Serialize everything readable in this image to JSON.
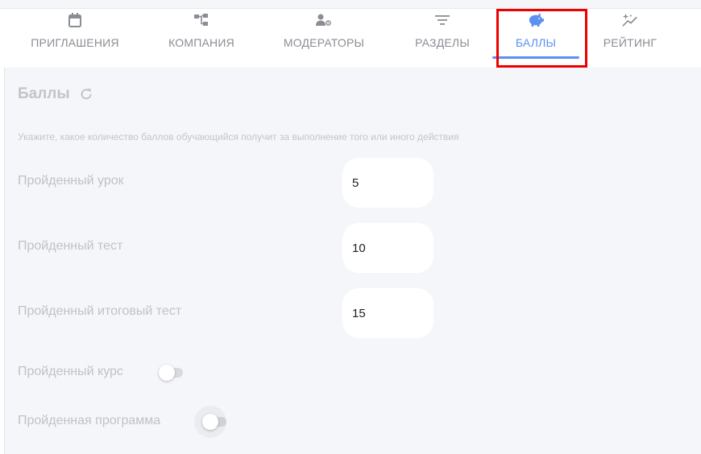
{
  "tabs": [
    {
      "label": "ПРИГЛАШЕНИЯ",
      "icon": "calendar-icon"
    },
    {
      "label": "КОМПАНИЯ",
      "icon": "org-structure-icon"
    },
    {
      "label": "МОДЕРАТОРЫ",
      "icon": "user-settings-icon"
    },
    {
      "label": "РАЗДЕЛЫ",
      "icon": "filter-list-icon"
    },
    {
      "label": "БАЛЛЫ",
      "icon": "piggy-bank-icon"
    },
    {
      "label": "РЕЙТИНГ",
      "icon": "sparkle-chart-icon"
    }
  ],
  "active_tab": "БАЛЛЫ",
  "section": {
    "title": "Баллы",
    "hint": "Укажите, какое количество баллов обучающийся получит за выполнение того или иного действия"
  },
  "fields": [
    {
      "label": "Пройденный урок",
      "value": "5"
    },
    {
      "label": "Пройденный тест",
      "value": "10"
    },
    {
      "label": "Пройденный итоговый тест",
      "value": "15"
    }
  ],
  "toggles": [
    {
      "label": "Пройденный курс",
      "checked": false
    },
    {
      "label": "Пройденная программа",
      "checked": false
    }
  ],
  "colors": {
    "accent": "#5b8ff2",
    "highlight": "#ee0000",
    "panel_bg": "#f5f6f9"
  }
}
